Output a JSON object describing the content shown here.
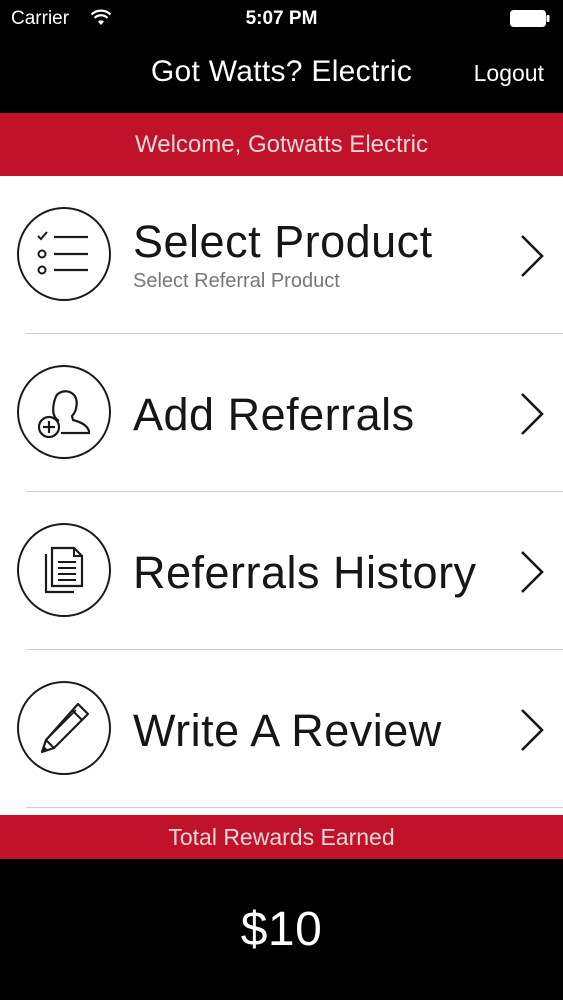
{
  "status_bar": {
    "carrier": "Carrier",
    "time": "5:07 PM",
    "icons": [
      "wifi-icon",
      "battery-icon"
    ]
  },
  "nav": {
    "title": "Got Watts? Electric",
    "logout_label": "Logout"
  },
  "welcome": {
    "text": "Welcome, Gotwatts Electric"
  },
  "menu": {
    "items": [
      {
        "label": "Select Product",
        "sublabel": "Select Referral Product",
        "icon": "checklist-icon"
      },
      {
        "label": "Add Referrals",
        "sublabel": "",
        "icon": "add-user-icon"
      },
      {
        "label": "Referrals History",
        "sublabel": "",
        "icon": "documents-icon"
      },
      {
        "label": "Write A Review",
        "sublabel": "",
        "icon": "pencil-icon"
      }
    ]
  },
  "rewards": {
    "label": "Total Rewards Earned",
    "amount": "$10"
  },
  "colors": {
    "accent_red": "#c0132a",
    "bar_black": "#000000",
    "text_dark": "#161616"
  }
}
